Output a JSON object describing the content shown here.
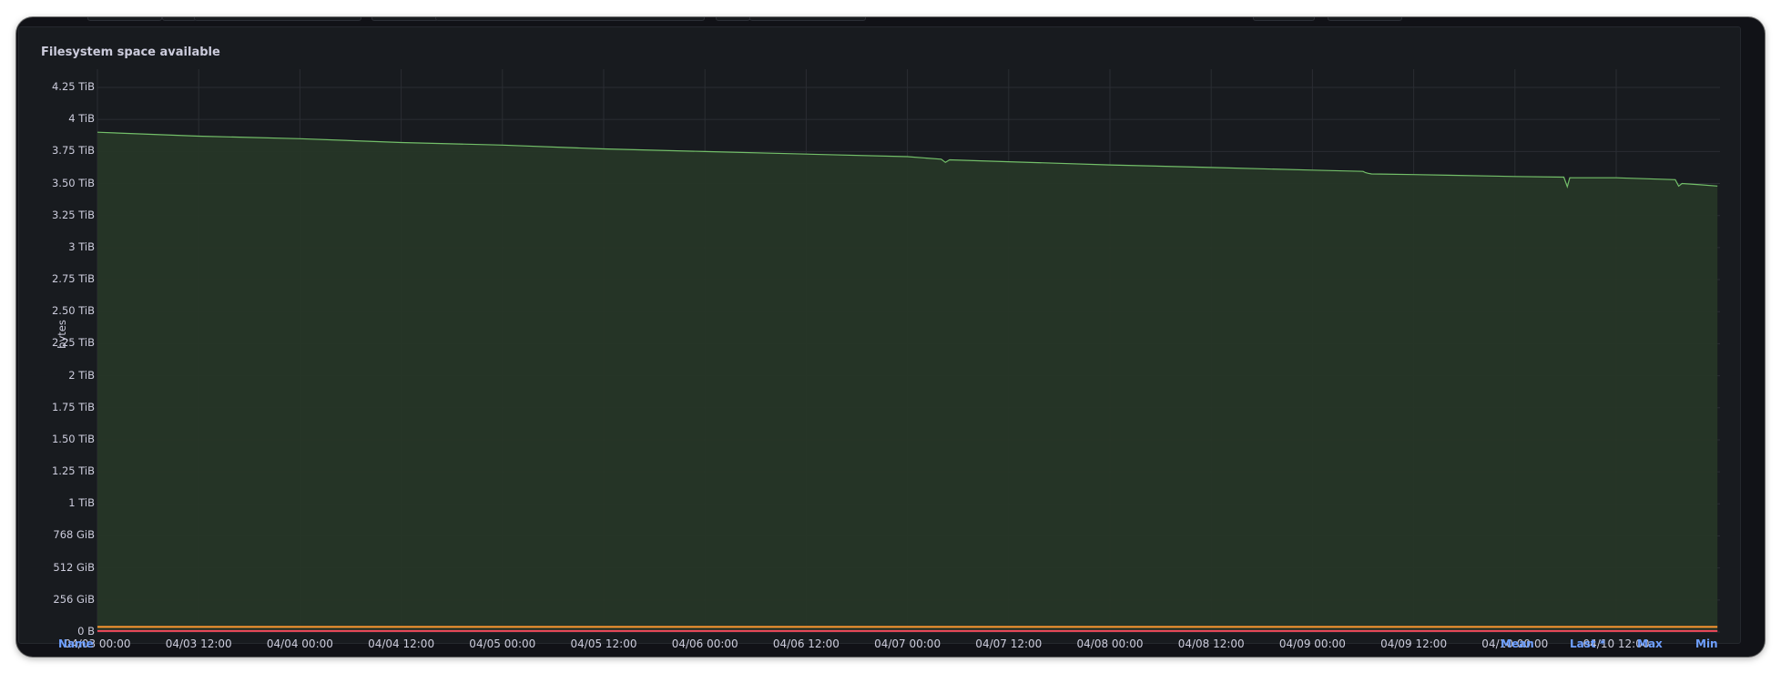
{
  "panel": {
    "title": "Filesystem space available"
  },
  "legend": {
    "name_header": "Name",
    "mean_header": "Mean",
    "last_header": "Last *",
    "max_header": "Max",
    "min_header": "Min"
  },
  "colors": {
    "background": "#111217",
    "panel": "#181b1f",
    "grid": "#2a2d33",
    "series_main": "#73bf69",
    "series_main_fill": "#263627",
    "series_orange": "#ff9830",
    "series_red": "#f2495c",
    "legend_header": "#6e9fff"
  },
  "chart_data": {
    "type": "area",
    "title": "Filesystem space available",
    "ylabel": "bytes",
    "xlabel": "",
    "y_unit": "TiB",
    "ylim": [
      0,
      4.25
    ],
    "y_ticks": [
      {
        "value": 4.25,
        "label": "4.25 TiB"
      },
      {
        "value": 4.0,
        "label": "4 TiB"
      },
      {
        "value": 3.75,
        "label": "3.75 TiB"
      },
      {
        "value": 3.5,
        "label": "3.50 TiB"
      },
      {
        "value": 3.25,
        "label": "3.25 TiB"
      },
      {
        "value": 3.0,
        "label": "3 TiB"
      },
      {
        "value": 2.75,
        "label": "2.75 TiB"
      },
      {
        "value": 2.5,
        "label": "2.50 TiB"
      },
      {
        "value": 2.25,
        "label": "2.25 TiB"
      },
      {
        "value": 2.0,
        "label": "2 TiB"
      },
      {
        "value": 1.75,
        "label": "1.75 TiB"
      },
      {
        "value": 1.5,
        "label": "1.50 TiB"
      },
      {
        "value": 1.25,
        "label": "1.25 TiB"
      },
      {
        "value": 1.0,
        "label": "1 TiB"
      },
      {
        "value": 0.75,
        "label": "768 GiB"
      },
      {
        "value": 0.5,
        "label": "512 GiB"
      },
      {
        "value": 0.25,
        "label": "256 GiB"
      },
      {
        "value": 0.0,
        "label": "0 B"
      }
    ],
    "x_ticks": [
      "04/03 00:00",
      "04/03 12:00",
      "04/04 00:00",
      "04/04 12:00",
      "04/05 00:00",
      "04/05 12:00",
      "04/06 00:00",
      "04/06 12:00",
      "04/07 00:00",
      "04/07 12:00",
      "04/08 00:00",
      "04/08 12:00",
      "04/09 00:00",
      "04/09 12:00",
      "04/10 00:00",
      "04/10 12:00"
    ],
    "x_hours_span": [
      0,
      192
    ],
    "grid": true,
    "legend_position": "bottom",
    "series": [
      {
        "color": "#73bf69",
        "fill": true,
        "x_hours": [
          0,
          12,
          24,
          36,
          48,
          60,
          72,
          84,
          96,
          100,
          100.5,
          101,
          108,
          120,
          132,
          144,
          150,
          150.3,
          150.6,
          151,
          156,
          160,
          168,
          173.8,
          174.2,
          174.5,
          180,
          187,
          187.4,
          187.8,
          190,
          192
        ],
        "values_tib": [
          3.9,
          3.87,
          3.85,
          3.82,
          3.8,
          3.77,
          3.75,
          3.73,
          3.71,
          3.69,
          3.665,
          3.685,
          3.67,
          3.645,
          3.625,
          3.605,
          3.595,
          3.585,
          3.58,
          3.575,
          3.57,
          3.565,
          3.555,
          3.55,
          3.475,
          3.545,
          3.545,
          3.53,
          3.48,
          3.5,
          3.49,
          3.48
        ]
      },
      {
        "color": "#ff9830",
        "fill": false,
        "x_hours": [
          0,
          192
        ],
        "values_tib": [
          0.04,
          0.04
        ]
      },
      {
        "color": "#f2495c",
        "fill": false,
        "x_hours": [
          0,
          192
        ],
        "values_tib": [
          0.008,
          0.008
        ]
      }
    ]
  }
}
